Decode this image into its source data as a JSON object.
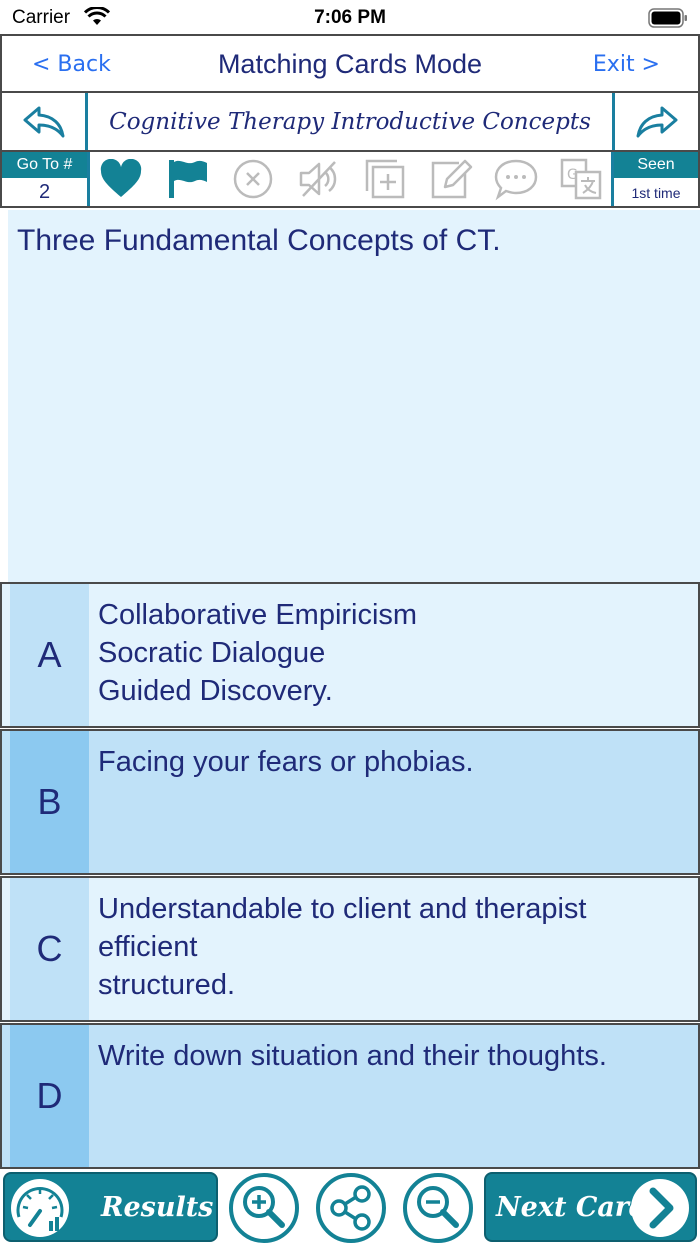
{
  "status_bar": {
    "carrier": "Carrier",
    "time": "7:06 PM"
  },
  "nav": {
    "back_label": "< Back",
    "title": "Matching Cards Mode",
    "exit_label": "Exit >"
  },
  "deck": {
    "title": "Cognitive Therapy Introductive Concepts"
  },
  "toolbar": {
    "goto_label": "Go To #",
    "goto_value": "2",
    "seen_label": "Seen",
    "seen_value": "1st time",
    "icons": [
      "heart-icon",
      "flag-icon",
      "close-circle-icon",
      "mute-icon",
      "add-card-icon",
      "edit-icon",
      "comment-icon",
      "translate-icon"
    ]
  },
  "question": {
    "text": "Three Fundamental Concepts of CT."
  },
  "answers": [
    {
      "letter": "A",
      "text": "Collaborative Empiricism\nSocratic Dialogue\nGuided Discovery."
    },
    {
      "letter": "B",
      "text": "Facing your fears or phobias."
    },
    {
      "letter": "C",
      "text": "Understandable to client and therapist\nefficient\nstructured."
    },
    {
      "letter": "D",
      "text": "Write down situation and their thoughts."
    }
  ],
  "bottom": {
    "results_label": "Results",
    "next_label": "Next Card"
  },
  "colors": {
    "teal": "#138295",
    "navy_text": "#1f2a78",
    "link_blue": "#2a6ff0",
    "light_card": "#e3f3fd",
    "mid_card": "#bfe1f7"
  }
}
